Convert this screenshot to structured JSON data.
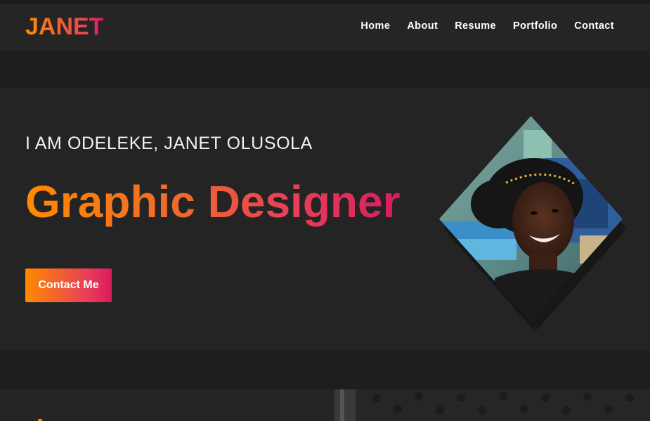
{
  "brand": {
    "logo_text": "JANET"
  },
  "nav": {
    "items": [
      {
        "label": "Home"
      },
      {
        "label": "About"
      },
      {
        "label": "Resume"
      },
      {
        "label": "Portfolio"
      },
      {
        "label": "Contact"
      }
    ]
  },
  "hero": {
    "intro": "I AM ODELEKE, JANET OLUSOLA",
    "role": "Graphic Designer",
    "cta_label": "Contact Me",
    "photo_icon": "profile-photo"
  },
  "colors": {
    "gradient_start": "#ff8a00",
    "gradient_end": "#da1b60",
    "background": "#1e1e1e",
    "panel": "#242424"
  }
}
